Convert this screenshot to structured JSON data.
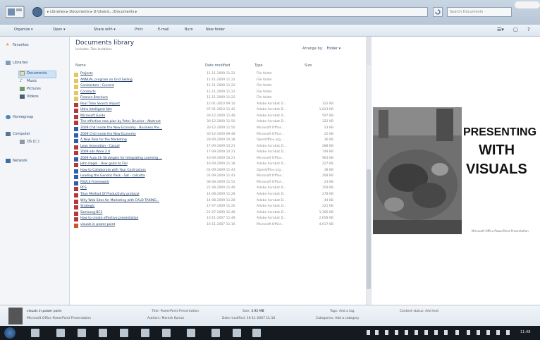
{
  "address_bar": {
    "text": "▸ Libraries ▸ Documents ▸ D:\\Users\\...\\Documents ▸"
  },
  "search": {
    "placeholder": "Search Documents"
  },
  "toolbar": {
    "organize": "Organize ▾",
    "open": "Open ▾",
    "share": "Share with ▾",
    "print": "Print",
    "email": "E-mail",
    "burn": "Burn",
    "new_folder": "New folder"
  },
  "nav": {
    "favorites": "Favorites",
    "libraries": "Libraries",
    "documents": "Documents",
    "music": "Music",
    "pictures": "Pictures",
    "videos": "Videos",
    "homegroup": "Homegroup",
    "computer": "Computer",
    "drive": "OS (C:)",
    "network": "Network"
  },
  "library": {
    "title": "Documents library",
    "subtitle": "Includes: Two locations",
    "arrange_label": "Arrange by:",
    "arrange_value": "Folder ▾"
  },
  "columns": {
    "name": "Name",
    "date": "Date modified",
    "type": "Type",
    "size": "Size"
  },
  "files": [
    {
      "name": "Projects",
      "date": "11-11-2009 11:22",
      "type": "File folder",
      "size": "",
      "kind": "folder"
    },
    {
      "name": "ANNUAL program on Grid Selling",
      "date": "11-11-2009 11:22",
      "type": "File folder",
      "size": "",
      "kind": "folder"
    },
    {
      "name": "Contractors - Current",
      "date": "11-11-2009 11:22",
      "type": "File folder",
      "size": "",
      "kind": "folder"
    },
    {
      "name": "Contracts",
      "date": "11-11-2009 11:22",
      "type": "File folder",
      "size": "",
      "kind": "folder"
    },
    {
      "name": "Finance Brochure",
      "date": "11-11-2009 11:22",
      "type": "File folder",
      "size": "",
      "kind": "folder"
    },
    {
      "name": "Real Time Search Impact",
      "date": "12-01-2010 09:10",
      "type": "Adobe Acrobat D...",
      "size": "322 KB",
      "kind": "pdf"
    },
    {
      "name": "Ultra Intelligent Net",
      "date": "07-01-2010 11:42",
      "type": "Adobe Acrobat D...",
      "size": "1,023 KB",
      "kind": "pdf"
    },
    {
      "name": "Microsoft Guide",
      "date": "30-12-2009 11:48",
      "type": "Adobe Acrobat D...",
      "size": "597 KB",
      "kind": "pdf"
    },
    {
      "name": "The effective new plan by Peter Drucker - Abstract",
      "date": "30-12-2009 11:50",
      "type": "Adobe Acrobat D...",
      "size": "322 KB",
      "kind": "pdf"
    },
    {
      "name": "2009 Ch4 Inside the New Economy - Business Pre...",
      "date": "30-12-2009 11:50",
      "type": "Microsoft Office...",
      "size": "23 KB",
      "kind": "doc"
    },
    {
      "name": "2009 Ch3 Inside the New Economy",
      "date": "30-12-2009 09:48",
      "type": "Microsoft Office...",
      "size": "22 KB",
      "kind": "doc"
    },
    {
      "name": "A New Role for the Marketing",
      "date": "28-09-2009 10:38",
      "type": "OpenOffice.org...",
      "size": "36 KB",
      "kind": "doc"
    },
    {
      "name": "Lean Innovation - Casual",
      "date": "17-09-2009 10:21",
      "type": "Adobe Acrobat D...",
      "size": "288 KB",
      "kind": "pdf"
    },
    {
      "name": "2009 ads Wine 2.0",
      "date": "17-09-2009 10:21",
      "type": "Adobe Acrobat D...",
      "size": "749 KB",
      "kind": "pdf"
    },
    {
      "name": "2009 Auto Ch Strategies for Integrating Learning ...",
      "date": "16-09-2009 10:21",
      "type": "Microsoft Office...",
      "size": "963 KB",
      "kind": "doc"
    },
    {
      "name": "John Hagel - How goals to Fail",
      "date": "16-09-2009 11:38",
      "type": "Adobe Acrobat D...",
      "size": "227 KB",
      "kind": "pdf"
    },
    {
      "name": "How to Collaborate with Your Contractors",
      "date": "01-09-2009 11:43",
      "type": "OpenOffice.org...",
      "size": "38 KB",
      "kind": "doc"
    },
    {
      "name": "Leading the Genetic Pack - Sat - calcutta",
      "date": "01-09-2009 11:43",
      "type": "Microsoft Office...",
      "size": "208 KB",
      "kind": "doc"
    },
    {
      "name": "RSVLS Framework",
      "date": "08-08-2009 11:52",
      "type": "Microsoft Office...",
      "size": "23 KB",
      "kind": "doc"
    },
    {
      "name": "RCS",
      "date": "21-08-2009 11:49",
      "type": "Adobe Acrobat D...",
      "size": "158 KB",
      "kind": "pdf"
    },
    {
      "name": "Trion Method Of Productivity protocol",
      "date": "14-08-2009 11:28",
      "type": "Adobe Acrobat D...",
      "size": "278 KB",
      "kind": "pdf"
    },
    {
      "name": "Why Web Sites for Marketing with CALD TAKING...",
      "date": "14-08-2009 11:28",
      "type": "Adobe Acrobat D...",
      "size": "44 KB",
      "kind": "pdf"
    },
    {
      "name": "Strategic",
      "date": "17-07-2009 11:20",
      "type": "Adobe Acrobat D...",
      "size": "221 KB",
      "kind": "pdf"
    },
    {
      "name": "Samsung-BC1",
      "date": "21-07-2009 11:48",
      "type": "Adobe Acrobat D...",
      "size": "1,366 KB",
      "kind": "pdf"
    },
    {
      "name": "How to create effective presentation",
      "date": "13-11-2007 11:48",
      "type": "Adobe Acrobat D...",
      "size": "2,658 KB",
      "kind": "pdf"
    },
    {
      "name": "visuals in power point",
      "date": "16-11-2007 11:16",
      "type": "Microsoft Office...",
      "size": "4,017 KB",
      "kind": "ppt"
    }
  ],
  "preview": {
    "line1": "PRESENTING",
    "line2": "WITH",
    "line3": "VISUALS",
    "caption": "Microsoft Office PowerPoint Presentation"
  },
  "details": {
    "filename": "visuals in power point",
    "filetype": "Microsoft Office PowerPoint Presentation",
    "title_label": "Title:",
    "title_value": "PowerPoint Presentation",
    "authors_label": "Authors:",
    "authors_value": "Manish Kumar",
    "size_label": "Size:",
    "size_value": "3.92 MB",
    "modified_label": "Date modified:",
    "modified_value": "16-11-2007 11:16",
    "tags_label": "Tags:",
    "tags_value": "Add a tag",
    "categories_label": "Categories:",
    "categories_value": "Add a category",
    "status_label": "Content status:",
    "status_value": "Add text"
  },
  "clock": {
    "time": "11:48"
  },
  "colors": {
    "accent": "#2b4d78",
    "selection": "#cfe3f7",
    "taskbar": "#151a20"
  }
}
